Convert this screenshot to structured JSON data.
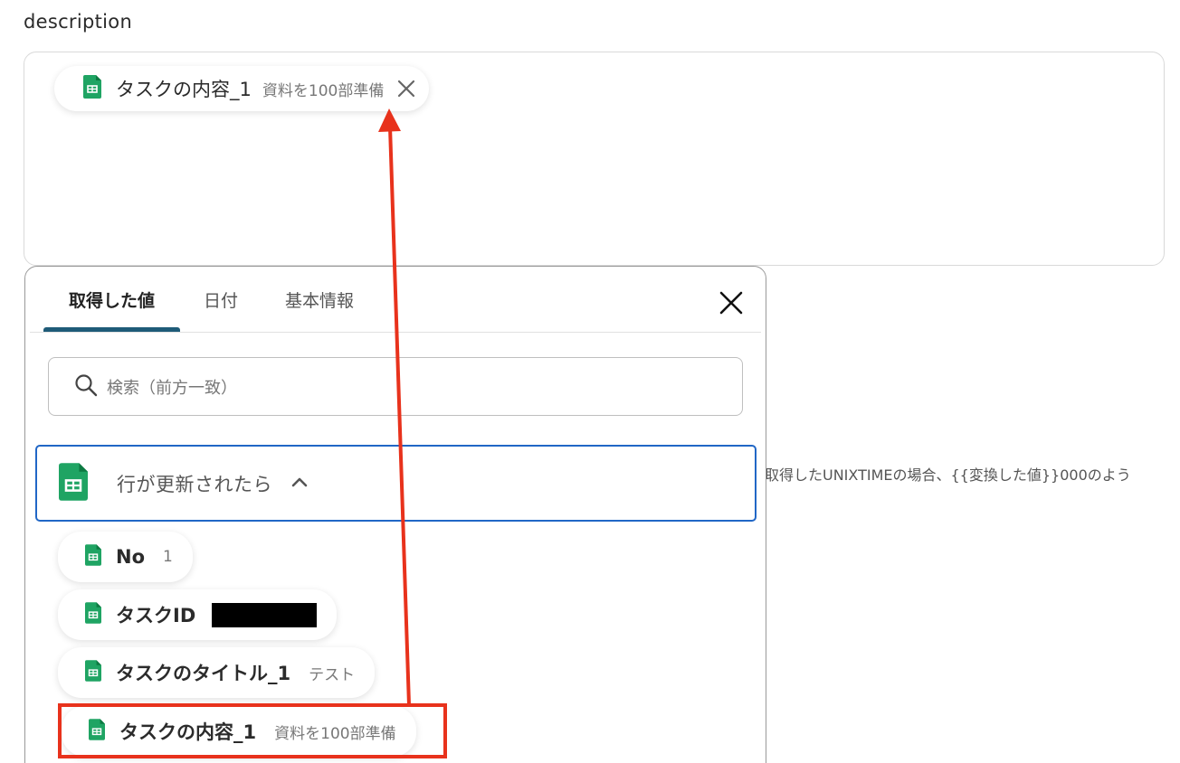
{
  "field": {
    "label": "description"
  },
  "chip": {
    "key": "タスクの内容_1",
    "value": "資料を100部準備"
  },
  "hint": {
    "text": "取得したUNIXTIMEの場合、{{変換した値}}000のよう"
  },
  "popup": {
    "tabs": [
      {
        "label": "取得した値",
        "active": true
      },
      {
        "label": "日付",
        "active": false
      },
      {
        "label": "基本情報",
        "active": false
      }
    ],
    "search": {
      "placeholder": "検索（前方一致）"
    },
    "trigger": {
      "label": "行が更新されたら"
    },
    "items": [
      {
        "key": "No",
        "value": "1"
      },
      {
        "key": "タスクID",
        "value": ""
      },
      {
        "key": "タスクのタイトル_1",
        "value": "テスト"
      },
      {
        "key": "タスクの内容_1",
        "value": "資料を100部準備"
      }
    ]
  },
  "colors": {
    "sheet_green": "#1fa463",
    "active_tab": "#1f5b78",
    "trigger_border": "#2167c6",
    "annotation_red": "#e8321c"
  },
  "icons": [
    "sheet-icon",
    "close-icon",
    "search-icon",
    "chevron-up-icon"
  ]
}
